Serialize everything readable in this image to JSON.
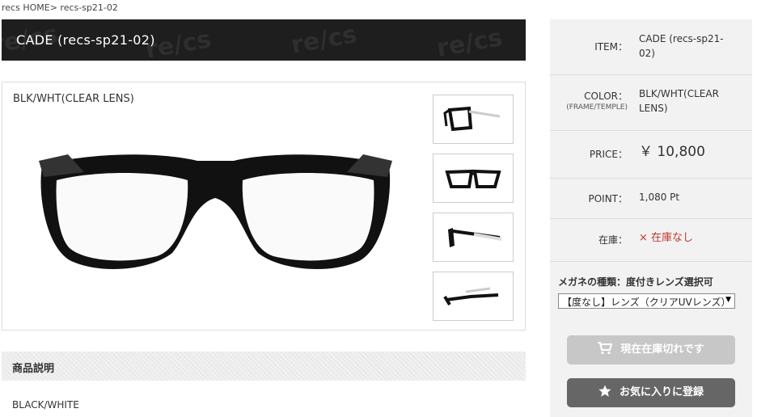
{
  "breadcrumb": {
    "home": "recs HOME",
    "separator": ">",
    "current": "recs-sp21-02"
  },
  "product": {
    "title": "CADE (recs-sp21-02)",
    "color_label": "BLK/WHT(CLEAR LENS)",
    "brand_pattern_text": "re/cs"
  },
  "thumbnails": [
    "front-angle",
    "front",
    "side",
    "side-open"
  ],
  "section": {
    "header": "商品説明"
  },
  "description": {
    "line1": "BLACK/WHITE"
  },
  "sidebar": {
    "item_label": "ITEM：",
    "item_value": "CADE (recs-sp21-02)",
    "color_label": "COLOR：",
    "color_sub": "(FRAME/TEMPLE)",
    "color_value": "BLK/WHT(CLEAR LENS)",
    "price_label": "PRICE：",
    "price_value": "￥ 10,800",
    "point_label": "POINT：",
    "point_value": "1,080 Pt",
    "stock_label": "在庫：",
    "stock_value": "× 在庫なし",
    "options_title": "メガネの種類：度付きレンズ選択可",
    "select_value": "【度なし】レンズ（クリアUVレンズ）",
    "sold_out_button": "現在在庫切れです",
    "favorite_button": "お気に入りに登録"
  },
  "colors": {
    "stock_red": "#c0392b",
    "sidebar_bg": "#f2f2f2",
    "title_bg": "#1e1e1e"
  }
}
